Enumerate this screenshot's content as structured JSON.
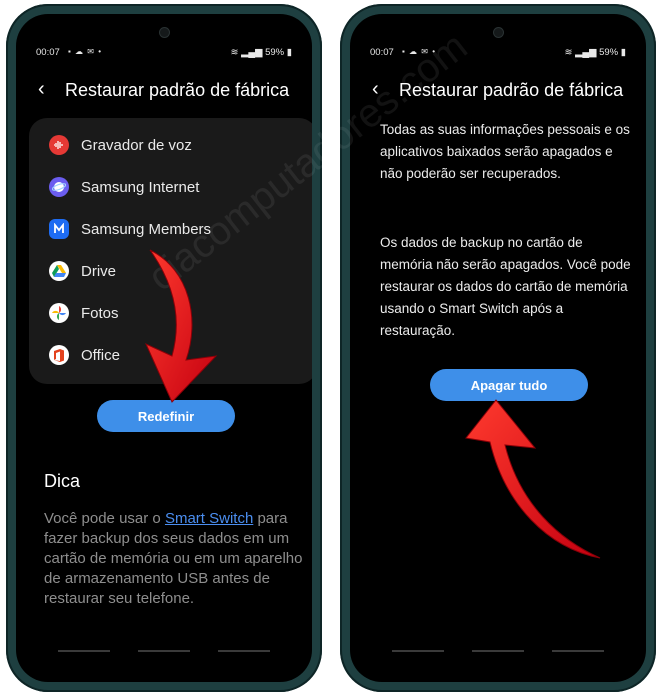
{
  "status": {
    "time": "00:07",
    "battery": "59%"
  },
  "left": {
    "title": "Restaurar padrão de fábrica",
    "apps": [
      {
        "label": "Gravador de voz",
        "icon": "voice-recorder-icon",
        "color": "#e53935"
      },
      {
        "label": "Samsung Internet",
        "icon": "samsung-internet-icon",
        "color": "#6b5df0"
      },
      {
        "label": "Samsung Members",
        "icon": "samsung-members-icon",
        "color": "#1e6cf2"
      },
      {
        "label": "Drive",
        "icon": "google-drive-icon",
        "color": "#ffffff"
      },
      {
        "label": "Fotos",
        "icon": "google-photos-icon",
        "color": "#ffffff"
      },
      {
        "label": "Office",
        "icon": "office-icon",
        "color": "#ffffff"
      }
    ],
    "reset_button": "Redefinir",
    "tip_title": "Dica",
    "tip_text_before": "Você pode usar o ",
    "tip_link": "Smart Switch",
    "tip_text_after": " para fazer backup dos seus dados em um cartão de memória ou em um aparelho de armazenamento USB antes de restaurar seu telefone."
  },
  "right": {
    "title": "Restaurar padrão de fábrica",
    "paragraph1": "Todas as suas informações pessoais e os aplicativos baixados serão apagados e não poderão ser recuperados.",
    "paragraph2": "Os dados de backup no cartão de memória não serão apagados. Você pode restaurar os dados do cartão de memória usando o Smart Switch após a restauração.",
    "erase_button": "Apagar tudo"
  },
  "watermark": "ciacomputadores.com",
  "colors": {
    "accent": "#3e8fe9",
    "link": "#4b8ef0",
    "arrow": "#e8101a",
    "frame": "#1e3f40"
  }
}
